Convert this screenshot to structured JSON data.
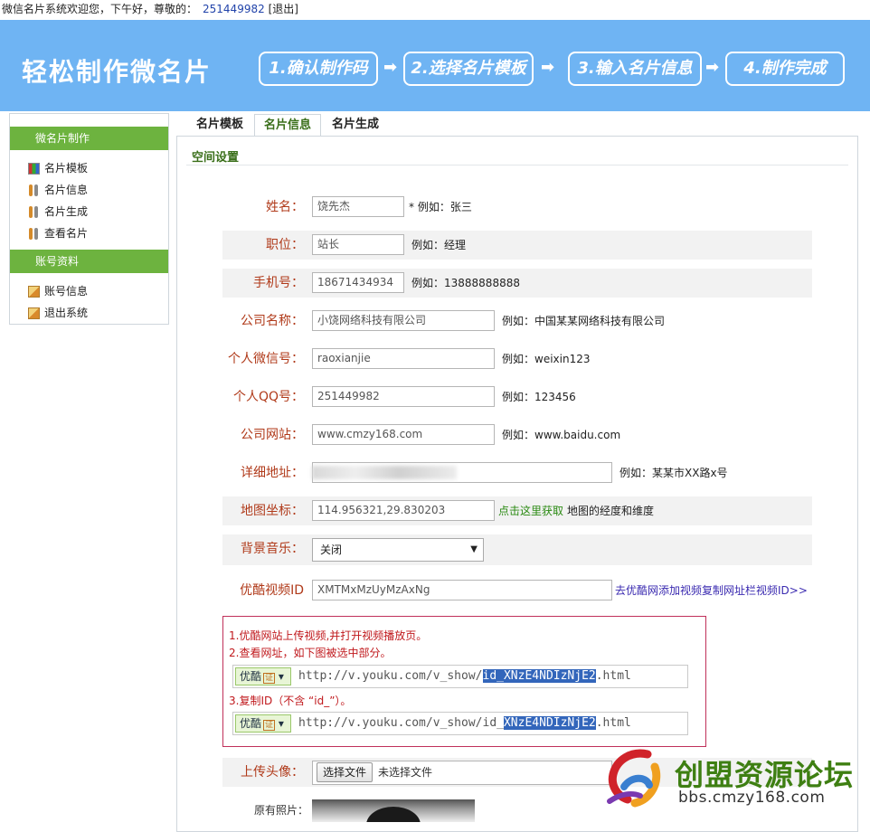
{
  "topbar": {
    "greeting": "微信名片系统欢迎您，下午好，尊敬的：",
    "user_id": "251449982",
    "logout": "[退出]"
  },
  "banner": {
    "brand": "轻松制作微名片",
    "steps": [
      "1.确认制作码",
      "2.选择名片模板",
      "3.输入名片信息",
      "4.制作完成"
    ],
    "arrow": "➡"
  },
  "sidebar": {
    "section1": "微名片制作",
    "items1": [
      "名片模板",
      "名片信息",
      "名片生成",
      "查看名片"
    ],
    "section2": "账号资料",
    "items2": [
      "账号信息",
      "退出系统"
    ]
  },
  "tabs": [
    "名片模板",
    "名片信息",
    "名片生成"
  ],
  "panel": {
    "title": "空间设置"
  },
  "form": {
    "name": {
      "label": "姓名：",
      "value": "饶先杰",
      "hint": "* 例如：张三"
    },
    "position": {
      "label": "职位：",
      "value": "站长",
      "hint": "例如：经理"
    },
    "mobile": {
      "label": "手机号：",
      "value": "18671434934",
      "hint": "例如：13888888888"
    },
    "company": {
      "label": "公司名称：",
      "value": "小饶网络科技有限公司",
      "hint": "例如：中国某某网络科技有限公司"
    },
    "wechat": {
      "label": "个人微信号：",
      "value": "raoxianjie",
      "hint": "例如：weixin123"
    },
    "qq": {
      "label": "个人QQ号：",
      "value": "251449982",
      "hint": "例如：123456"
    },
    "website": {
      "label": "公司网站：",
      "value": "www.cmzy168.com",
      "hint": "例如：www.baidu.com"
    },
    "address": {
      "label": "详细地址：",
      "value": "",
      "hint": "例如：某某市XX路x号"
    },
    "map": {
      "label": "地图坐标：",
      "value": "114.956321,29.830203",
      "link": "点击这里获取",
      "hint": "地图的经度和维度"
    },
    "music": {
      "label": "背景音乐：",
      "value": "关闭"
    },
    "youku": {
      "label": "优酷视频ID",
      "value": "XMTMxMzUyMzAxNg",
      "link": "去优酷网添加视频复制网址栏视频ID>>"
    },
    "avatar": {
      "label": "上传头像：",
      "button": "选择文件",
      "status": "未选择文件"
    },
    "photo_label": "原有照片："
  },
  "help": {
    "line1": "1.优酷网站上传视频,并打开视频播放页。",
    "line2": "2.查看网址，如下图被选中部分。",
    "line3": "3.复制ID（不含 “id_”）。",
    "tag": "优酷",
    "cert": "证",
    "url1_prefix": "http://v.youku.com/v_show/",
    "url1_hl": "id_XNzE4NDIzNjE2",
    "url1_suffix": ".html",
    "url2_prefix": "http://v.youku.com/v_show/id_",
    "url2_hl": "XNzE4NDIzNjE2",
    "url2_suffix": ".html"
  },
  "watermark": {
    "title": "创盟资源论坛",
    "url": "bbs.cmzy168.com"
  },
  "colors": {
    "banner": "#6fb4f3",
    "sidebar_header": "#6db33f",
    "label": "#b03a1a",
    "help_text": "#c0181c",
    "highlight": "#3366bb"
  }
}
